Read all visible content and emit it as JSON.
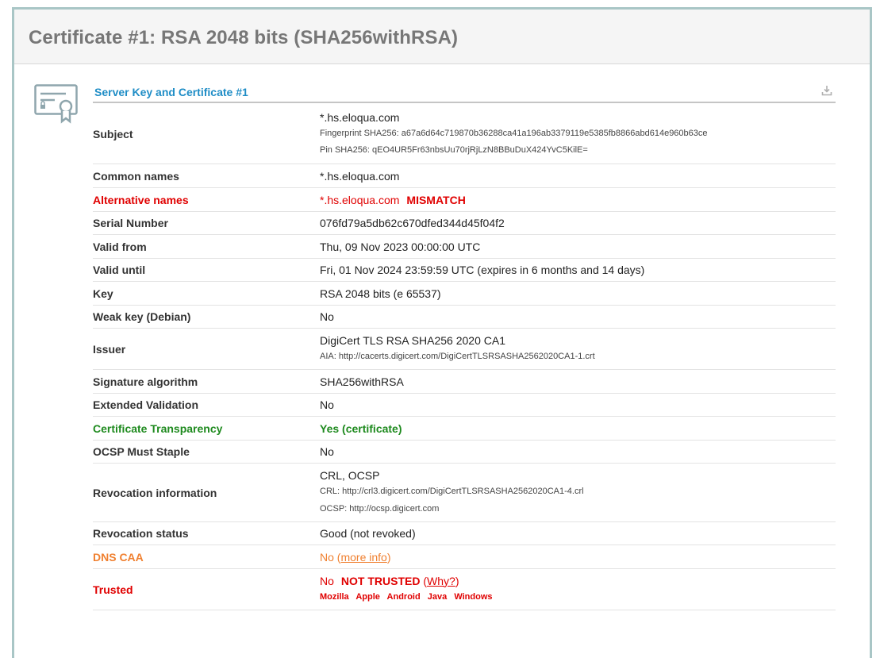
{
  "title": "Certificate #1: RSA 2048 bits (SHA256withRSA)",
  "section_title": "Server Key and Certificate #1",
  "icons": {
    "certificate": "certificate-icon",
    "download": "download-icon"
  },
  "colors": {
    "accent": "#1f8dc6",
    "error": "#e00000",
    "success": "#1e8a1e",
    "warning": "#f08030"
  },
  "rows": {
    "subject": {
      "label": "Subject",
      "value": "*.hs.eloqua.com",
      "fingerprint": "Fingerprint SHA256: a67a6d64c719870b36288ca41a196ab3379119e5385fb8866abd614e960b63ce",
      "pin": "Pin SHA256: qEO4UR5Fr63nbsUu70rjRjLzN8BBuDuX424YvC5KilE="
    },
    "common_names": {
      "label": "Common names",
      "value": "*.hs.eloqua.com"
    },
    "alt_names": {
      "label": "Alternative names",
      "value": "*.hs.eloqua.com",
      "flag": "MISMATCH"
    },
    "serial": {
      "label": "Serial Number",
      "value": "076fd79a5db62c670dfed344d45f04f2"
    },
    "valid_from": {
      "label": "Valid from",
      "value": "Thu, 09 Nov 2023 00:00:00 UTC"
    },
    "valid_until": {
      "label": "Valid until",
      "value": "Fri, 01 Nov 2024 23:59:59 UTC (expires in 6 months and 14 days)"
    },
    "key": {
      "label": "Key",
      "value": "RSA 2048 bits (e 65537)"
    },
    "weak_key": {
      "label": "Weak key (Debian)",
      "value": "No"
    },
    "issuer": {
      "label": "Issuer",
      "value": "DigiCert TLS RSA SHA256 2020 CA1",
      "aia": "AIA: http://cacerts.digicert.com/DigiCertTLSRSASHA2562020CA1-1.crt"
    },
    "sig_alg": {
      "label": "Signature algorithm",
      "value": "SHA256withRSA"
    },
    "ev": {
      "label": "Extended Validation",
      "value": "No"
    },
    "ct": {
      "label": "Certificate Transparency",
      "value": "Yes (certificate)"
    },
    "ocsp_staple": {
      "label": "OCSP Must Staple",
      "value": "No"
    },
    "revocation_info": {
      "label": "Revocation information",
      "value": "CRL, OCSP",
      "crl": "CRL: http://crl3.digicert.com/DigiCertTLSRSASHA2562020CA1-4.crl",
      "ocsp": "OCSP: http://ocsp.digicert.com"
    },
    "revocation_status": {
      "label": "Revocation status",
      "value": "Good (not revoked)"
    },
    "dns_caa": {
      "label": "DNS CAA",
      "value": "No",
      "link_open": "(",
      "link": "more info",
      "link_close": ")"
    },
    "trusted": {
      "label": "Trusted",
      "value": "No",
      "flag": "NOT TRUSTED",
      "link_open": "(",
      "link": "Why?",
      "link_close": ")",
      "stores": [
        "Mozilla",
        "Apple",
        "Android",
        "Java",
        "Windows"
      ]
    }
  }
}
